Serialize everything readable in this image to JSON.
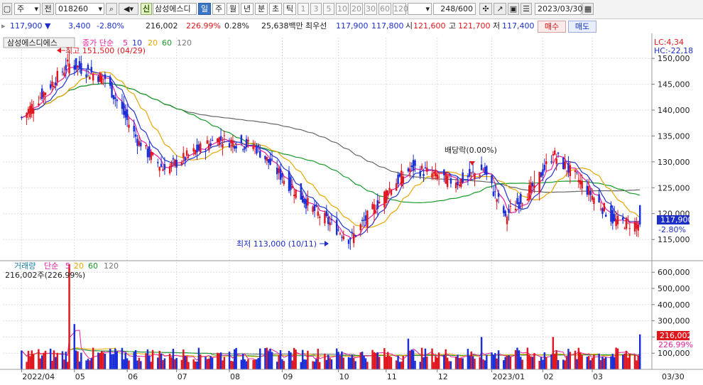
{
  "toolbar": {
    "market": "주",
    "period_prefix": "전",
    "code": "018260",
    "credit_badge": "신",
    "stock_name": "삼성에스디",
    "timeframes": [
      "일",
      "주",
      "월",
      "년",
      "분",
      "초",
      "틱"
    ],
    "intervals": [
      "1",
      "3",
      "5",
      "10",
      "20",
      "30",
      "60",
      "120"
    ],
    "count": "248/600",
    "date": "2023/03/30"
  },
  "quote": {
    "price": "117,900",
    "change": "3,400",
    "change_pct": "-2.80%",
    "volume": "216,002",
    "volume_ratio": "226.99%",
    "turnover": "0.28%",
    "amount": "25,638백만",
    "best_label": "최우선",
    "ask": "117,900",
    "bid": "117,800",
    "open_label": "시",
    "open": "121,600",
    "high_label": "고",
    "high": "121,700",
    "low_label": "저",
    "low": "117,400",
    "buy": "매수",
    "sell": "매도"
  },
  "chart_data": [
    {
      "type": "candlestick",
      "title": "삼성에스디에스",
      "legend": {
        "label": "종가 단순",
        "periods": [
          "5",
          "10",
          "20",
          "60",
          "120"
        ]
      },
      "series_colors": {
        "ma5": "#e81fa0",
        "ma10": "#2233cc",
        "ma20": "#e8a800",
        "ma60": "#1a9a2a",
        "ma120": "#666666",
        "up": "#e0171f",
        "down": "#1a2fd8"
      },
      "corner_labels": [
        "LC:4,34",
        "HC:-22,18"
      ],
      "y_ticks": [
        "150,000",
        "145,000",
        "140,000",
        "135,000",
        "130,000",
        "125,000",
        "120,000",
        "115,000"
      ],
      "ylim": [
        112000,
        154000
      ],
      "x_ticks": [
        "2022/04",
        "05",
        "06",
        "07",
        "08",
        "09",
        "10",
        "11",
        "12",
        "2023/01",
        "02",
        "03",
        "03/30"
      ],
      "annotations": {
        "high": "최고 151,500 (04/29)",
        "low": "최저 113,000 (10/11)",
        "dividend": "배당락(0.00%)"
      },
      "last_price": "117,900",
      "last_change": "-2.80%",
      "key_points": [
        {
          "date": "2022/04/01",
          "close": 138500
        },
        {
          "date": "2022/04/29",
          "close": 149000,
          "high": 151500
        },
        {
          "date": "2022/05/20",
          "close": 146000
        },
        {
          "date": "2022/06/10",
          "close": 133000
        },
        {
          "date": "2022/06/24",
          "close": 128500
        },
        {
          "date": "2022/07/25",
          "close": 134500
        },
        {
          "date": "2022/08/16",
          "close": 133000
        },
        {
          "date": "2022/09/01",
          "close": 127000
        },
        {
          "date": "2022/09/20",
          "close": 120500
        },
        {
          "date": "2022/10/11",
          "close": 115000,
          "low": 113000
        },
        {
          "date": "2022/11/02",
          "close": 124500
        },
        {
          "date": "2022/11/16",
          "close": 129000
        },
        {
          "date": "2022/12/12",
          "close": 126000
        },
        {
          "date": "2022/12/28",
          "close": 128500
        },
        {
          "date": "2023/01/10",
          "close": 119500
        },
        {
          "date": "2023/01/27",
          "close": 125500
        },
        {
          "date": "2023/02/07",
          "close": 131500
        },
        {
          "date": "2023/02/22",
          "close": 126500
        },
        {
          "date": "2023/03/15",
          "close": 118500
        },
        {
          "date": "2023/03/30",
          "open": 121600,
          "high": 121700,
          "low": 117400,
          "close": 117900
        }
      ]
    },
    {
      "type": "bar",
      "title": "거래량",
      "legend": {
        "label": "단순",
        "periods": [
          "5",
          "20",
          "60",
          "120"
        ]
      },
      "summary": "216,002주(226.99%)",
      "y_ticks": [
        "600,000",
        "500,000",
        "400,000",
        "300,000",
        "200,000",
        "100,000"
      ],
      "ylim": [
        0,
        680000
      ],
      "last_volume": "216,002",
      "last_ratio": "226.99%",
      "key_points": [
        {
          "date": "2022/04/29",
          "volume": 650000
        },
        {
          "date": "2022/05/02",
          "volume": 280000
        },
        {
          "date": "2022/11/14",
          "volume": 190000
        },
        {
          "date": "2022/12/27",
          "volume": 200000
        },
        {
          "date": "2023/02/07",
          "volume": 200000
        },
        {
          "date": "2023/03/30",
          "volume": 216002
        }
      ]
    }
  ]
}
